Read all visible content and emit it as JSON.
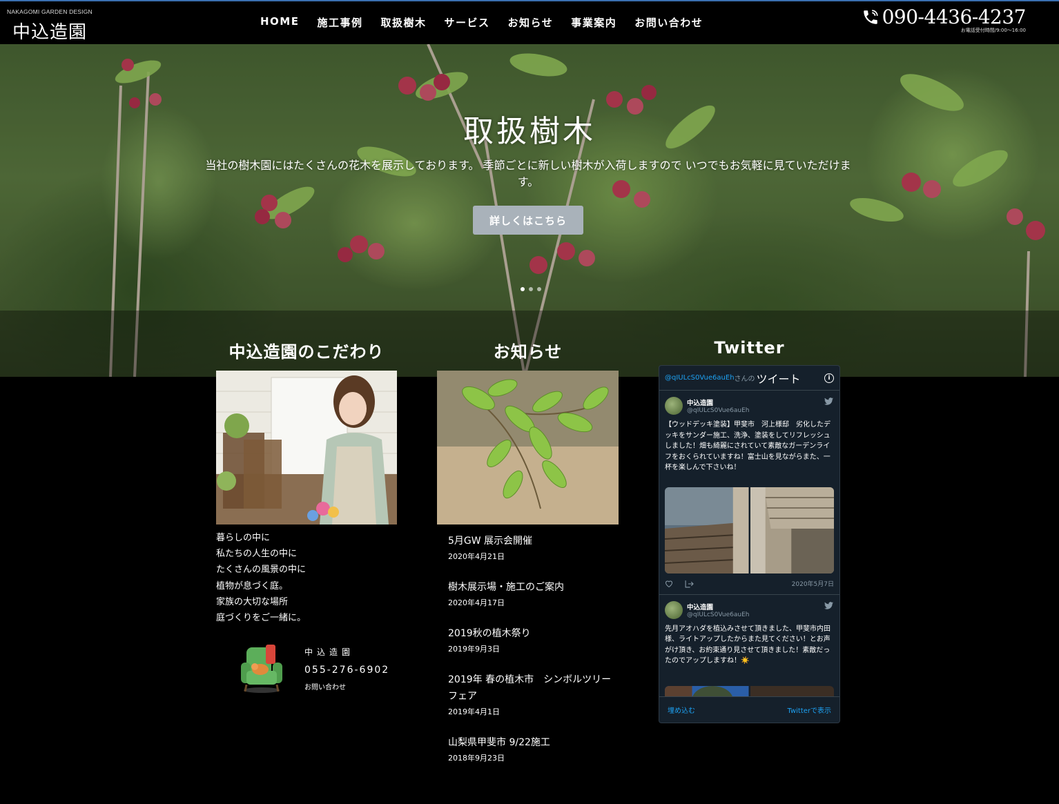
{
  "header": {
    "logo_sub": "NAKAGOMI GARDEN DESIGN",
    "logo_main": "中込造園",
    "nav": [
      "HOME",
      "施工事例",
      "取扱樹木",
      "サービス",
      "お知らせ",
      "事業案内",
      "お問い合わせ"
    ],
    "phone": "090-4436-4237",
    "phone_hours": "お電話受付時間/9:00〜16:00"
  },
  "hero": {
    "title": "取扱樹木",
    "text": "当社の樹木園にはたくさんの花木を展示しております。 季節ごとに新しい樹木が入荷しますので いつでもお気軽に見ていただけます。",
    "button": "詳しくはこちら",
    "slides": 3,
    "active_slide": 1
  },
  "kodawari": {
    "heading": "中込造園のこだわり",
    "lines": [
      "暮らしの中に",
      "私たちの人生の中に",
      "たくさんの風景の中に",
      "植物が息づく庭。",
      "家族の大切な場所",
      "庭づくりをご一緒に。"
    ],
    "shop_name": "中込造園",
    "shop_tel": "055-276-6902",
    "shop_contact": "お問い合わせ"
  },
  "news": {
    "heading": "お知らせ",
    "items": [
      {
        "title": "5月GW 展示会開催",
        "date": "2020年4月21日"
      },
      {
        "title": "樹木展示場・施工のご案内",
        "date": "2020年4月17日"
      },
      {
        "title": "2019秋の植木祭り",
        "date": "2019年9月3日"
      },
      {
        "title": "2019年 春の植木市　シンボルツリーフェア",
        "date": "2019年4月1日"
      },
      {
        "title": "山梨県甲斐市 9/22施工",
        "date": "2018年9月23日"
      }
    ]
  },
  "twitter": {
    "heading": "Twitter",
    "handle_link": "@qIULcS0Vue6auEh",
    "san_no": "さんの",
    "title": "ツイート",
    "tweets": [
      {
        "name": "中込造園",
        "handle": "@qIULcS0Vue6auEh",
        "text": "【ウッドデッキ塗装】甲斐市　河上様邸　劣化したデッキをサンダー施工、洗浄、塗装をしてリフレッシュしました！畑も綺麗にされていて素敵なガーデンライフをおくられていますね！富士山を見ながらまた、一杯を楽しんで下さいね！",
        "date": "2020年5月7日"
      },
      {
        "name": "中込造園",
        "handle": "@qIULcS0Vue6auEh",
        "text": "先月アオハダを植込みさせて頂きました、甲斐市内田様、ライトアップしたからまた見てください！とお声がけ頂き、お約束通り見させて頂きました！素敵だったのでアップしますね！☀️"
      }
    ],
    "embed": "埋め込む",
    "view": "Twitterで表示"
  },
  "colors": {
    "header_bg": "#000000",
    "hero_button": "#a9b2ba",
    "twitter_bg": "#15202b",
    "twitter_link": "#1da1f2"
  }
}
